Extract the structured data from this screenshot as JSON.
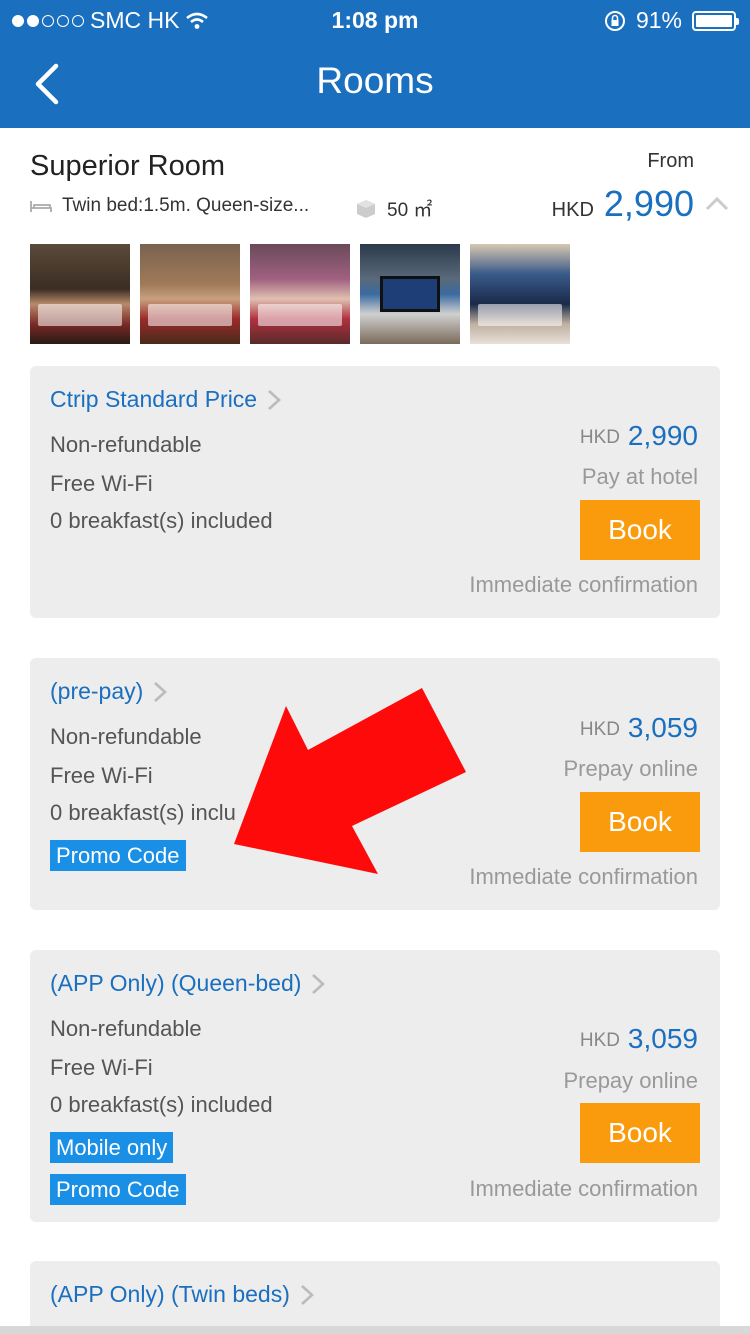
{
  "status_bar": {
    "carrier": "SMC HK",
    "time": "1:08 pm",
    "battery": "91%",
    "battery_level": 0.91,
    "signal_bars": 2
  },
  "nav": {
    "title": "Rooms"
  },
  "room": {
    "name": "Superior Room",
    "bed": "Twin bed:1.5m. Queen-size...",
    "area": "50 ㎡",
    "from_label": "From",
    "currency": "HKD",
    "from_price": "2,990"
  },
  "photos": [
    "bedroom-photo",
    "bedroom-photo",
    "bedroom-photo",
    "tv-photo",
    "bathtub-view-photo"
  ],
  "rates": [
    {
      "name": "Ctrip Standard Price",
      "refund": "Non-refundable",
      "wifi": "Free Wi-Fi",
      "breakfast": "0 breakfast(s) included",
      "currency": "HKD",
      "price": "2,990",
      "payment": "Pay at hotel",
      "book": "Book",
      "confirmation": "Immediate confirmation"
    },
    {
      "name": "(pre-pay)",
      "refund": "Non-refundable",
      "wifi": "Free Wi-Fi",
      "breakfast": "0 breakfast(s) inclu",
      "tag": "Promo Code",
      "currency": "HKD",
      "price": "3,059",
      "payment": "Prepay online",
      "book": "Book",
      "confirmation": "Immediate confirmation"
    },
    {
      "name": "(APP Only) (Queen-bed)",
      "refund": "Non-refundable",
      "wifi": "Free Wi-Fi",
      "breakfast": "0 breakfast(s) included",
      "tag1": "Mobile only",
      "tag2": "Promo Code",
      "currency": "HKD",
      "price": "3,059",
      "payment": "Prepay online",
      "book": "Book",
      "confirmation": "Immediate confirmation"
    },
    {
      "name": "(APP Only) (Twin beds)"
    }
  ],
  "colors": {
    "brand_blue": "#1a6fbf",
    "book_orange": "#f99b0c",
    "tag_blue": "#1a8fe6",
    "arrow_red": "#ff0a0a"
  }
}
